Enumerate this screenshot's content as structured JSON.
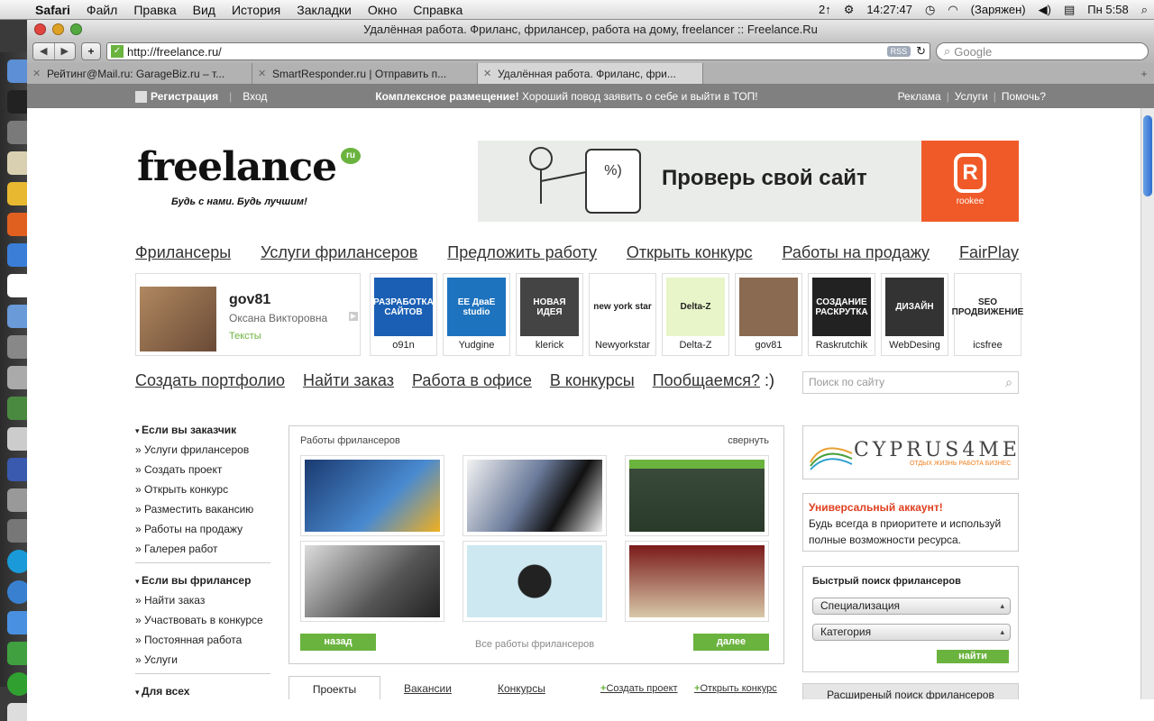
{
  "menubar": {
    "app": "Safari",
    "items": [
      "Файл",
      "Правка",
      "Вид",
      "История",
      "Закладки",
      "Окно",
      "Справка"
    ],
    "status": {
      "num": "2↑",
      "time_counter": "14:27:47",
      "battery": "(Заряжен)",
      "clock": "Пн 5:58"
    }
  },
  "window": {
    "title": "Удалённая работа. Фриланс, фрилансер, работа на дому, freelancer :: Freelance.Ru",
    "url": "http://freelance.ru/",
    "rss": "RSS",
    "search_placeholder": "Google",
    "tabs": [
      "Рейтинг@Mail.ru: GarageBiz.ru – т...",
      "SmartResponder.ru | Отправить п...",
      "Удалённая работа. Фриланс, фри..."
    ]
  },
  "sitebar": {
    "register": "Регистрация",
    "login": "Вход",
    "promo_bold": "Комплексное размещение!",
    "promo_text": " Хороший повод заявить о себе и выйти в ТОП!",
    "links": [
      "Реклама",
      "Услуги",
      "Помочь?"
    ]
  },
  "logo": {
    "text": "freelance",
    "badge": "ru",
    "slogan": "Будь с нами. Будь лучшим!"
  },
  "banner": {
    "text": "Проверь свой сайт",
    "brand": "rookee",
    "phone": "%)"
  },
  "mainnav": [
    "Фрилансеры",
    "Услуги фрилансеров",
    "Предложить работу",
    "Открыть конкурс",
    "Работы на продажу",
    "FairPlay"
  ],
  "featured_user": {
    "username": "gov81",
    "fullname": "Оксана Викторовна",
    "category": "Тексты"
  },
  "freelancers": [
    {
      "name": "o91n",
      "thumb": "РАЗРАБОТКА САЙТОВ",
      "color": "#1a5fb4"
    },
    {
      "name": "Yudgine",
      "thumb": "EE ДваЕ studio",
      "color": "#1e73be"
    },
    {
      "name": "klerick",
      "thumb": "НОВАЯ ИДЕЯ",
      "color": "#444444"
    },
    {
      "name": "Newyorkstar",
      "thumb": "new york star",
      "color": "#ffffff"
    },
    {
      "name": "Delta-Z",
      "thumb": "Delta-Z",
      "color": "#e8f5c8"
    },
    {
      "name": "gov81",
      "thumb": "",
      "color": "#8a6a50"
    },
    {
      "name": "Raskrutchik",
      "thumb": "СОЗДАНИЕ РАСКРУТКА",
      "color": "#222222"
    },
    {
      "name": "WebDesing",
      "thumb": "ДИЗАЙН",
      "color": "#333333"
    },
    {
      "name": "icsfree",
      "thumb": "SEO ПРОДВИЖЕНИЕ",
      "color": "#ffffff"
    }
  ],
  "subnav": [
    "Создать портфолио",
    "Найти заказ",
    "Работа в офисе",
    "В конкурсы",
    "Пообщаемся?"
  ],
  "subnav_smile": " :)",
  "site_search_placeholder": "Поиск по сайту",
  "sidebar": {
    "client_header": "Если вы заказчик",
    "client_items": [
      "Услуги фрилансеров",
      "Создать проект",
      "Открыть конкурс",
      "Разместить вакансию",
      "Работы на продажу",
      "Галерея работ"
    ],
    "freelancer_header": "Если вы фрилансер",
    "freelancer_items": [
      "Найти заказ",
      "Участвовать в конкурсе",
      "Постоянная работа",
      "Услуги"
    ],
    "all_header": "Для всех"
  },
  "works": {
    "title": "Работы фрилансеров",
    "collapse": "свернуть",
    "back": "назад",
    "all": "Все работы фрилансеров",
    "next": "далее"
  },
  "project_tabs": {
    "active": "Проекты",
    "tabs": [
      "Вакансии",
      "Конкурсы"
    ],
    "create_project": "Создать проект",
    "open_contest": "Открыть конкурс"
  },
  "cyprus": {
    "title": "CYPRUS4ME",
    "subtitle": "ОТДЫХ ЖИЗНЬ РАБОТА БИЗНЕС"
  },
  "universal_account": {
    "header": "Универсальный аккаунт!",
    "text": "Будь всегда в приоритете и используй полные возможности ресурса."
  },
  "quick_search": {
    "title": "Быстрый поиск фрилансеров",
    "spec": "Специализация",
    "category": "Категория",
    "button": "найти"
  },
  "advanced_search": "Расширеный поиск фрилансеров"
}
